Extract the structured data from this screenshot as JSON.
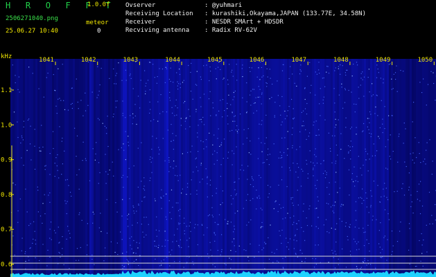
{
  "header": {
    "app_name": "H R O F F T",
    "version": "1.0.0f",
    "filename": "2506271040.png",
    "timestamp": "25.06.27 10:40",
    "meteor_label": "meteor",
    "meteor_count": "0"
  },
  "info": [
    {
      "label": "Ovserver",
      "value": ": @yuhmari"
    },
    {
      "label": "Receiving Location",
      "value": ": kurashiki,Okayama,JAPAN (133.77E, 34.58N)"
    },
    {
      "label": "Receiver",
      "value": ": NESDR SMArt + HDSDR"
    },
    {
      "label": "Recviving antenna",
      "value": ": Radix RV-62V"
    }
  ],
  "freq_axis": {
    "unit": "kHz",
    "labels": [
      "1041",
      "1042",
      "1043",
      "1044",
      "1045",
      "1046",
      "1047",
      "1048",
      "1049",
      "1050"
    ]
  },
  "time_axis": {
    "labels": [
      "1.1",
      "1.0",
      "0.9",
      "0.8",
      "0.7",
      "0.6"
    ]
  },
  "colors": {
    "background": "#000000",
    "spectrum": "#0a0c70",
    "signal": "#1ed2ff",
    "axis_text": "#f0e600",
    "title": "#21d24a"
  }
}
